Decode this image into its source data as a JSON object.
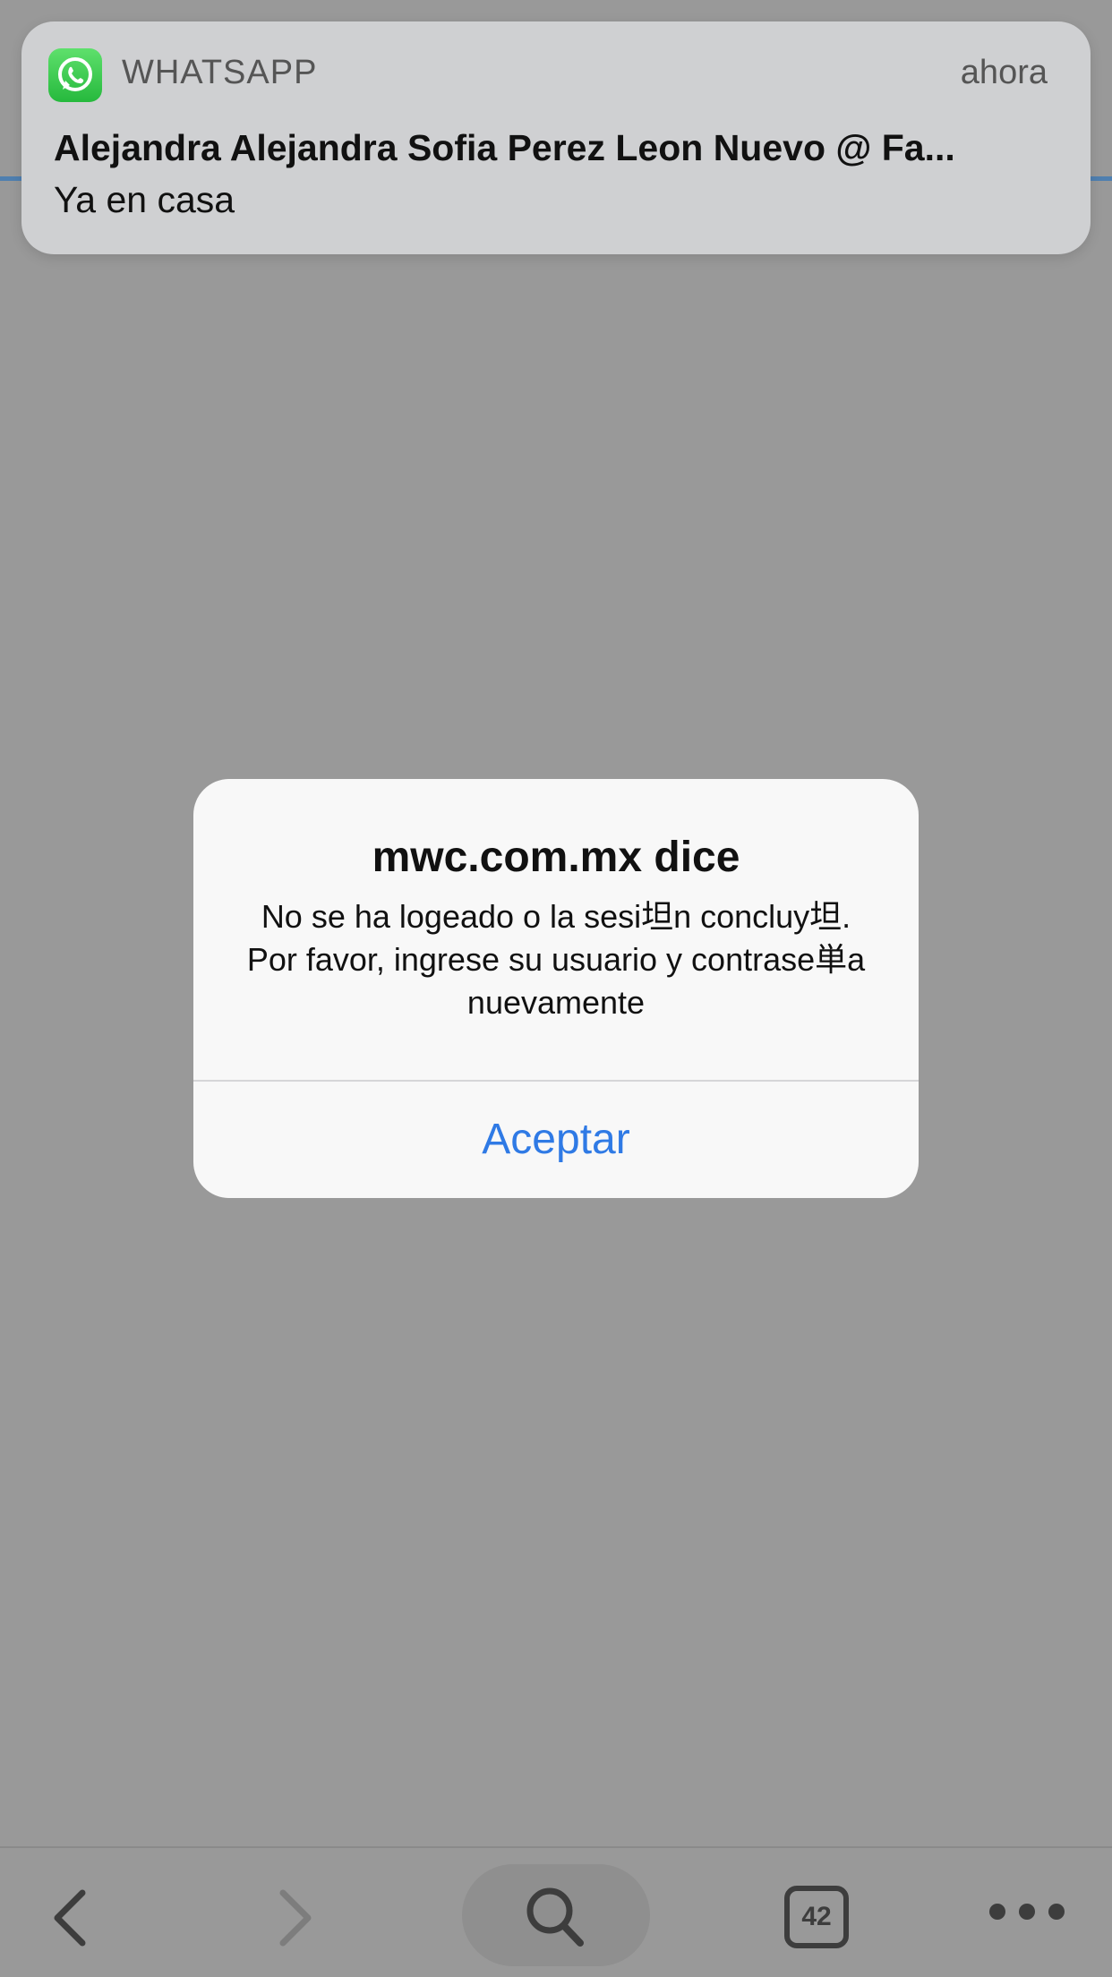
{
  "notification": {
    "app_name": "WHATSAPP",
    "time": "ahora",
    "title": "Alejandra Alejandra Sofia Perez Leon Nuevo @ Fa...",
    "body": "Ya en casa",
    "icon": "whatsapp-icon"
  },
  "alert": {
    "title": "mwc.com.mx dice",
    "message": "No se ha logeado o la sesi坦n concluy坦. Por favor, ingrese su usuario y contrase単a nuevamente",
    "button_label": "Aceptar"
  },
  "toolbar": {
    "back_icon": "chevron-left-icon",
    "forward_icon": "chevron-right-icon",
    "search_icon": "search-icon",
    "tab_count": "42",
    "more_icon": "more-icon"
  },
  "colors": {
    "accent": "#2f7ae5",
    "whatsapp_green": "#26b93d",
    "dim_background": "#999999"
  }
}
